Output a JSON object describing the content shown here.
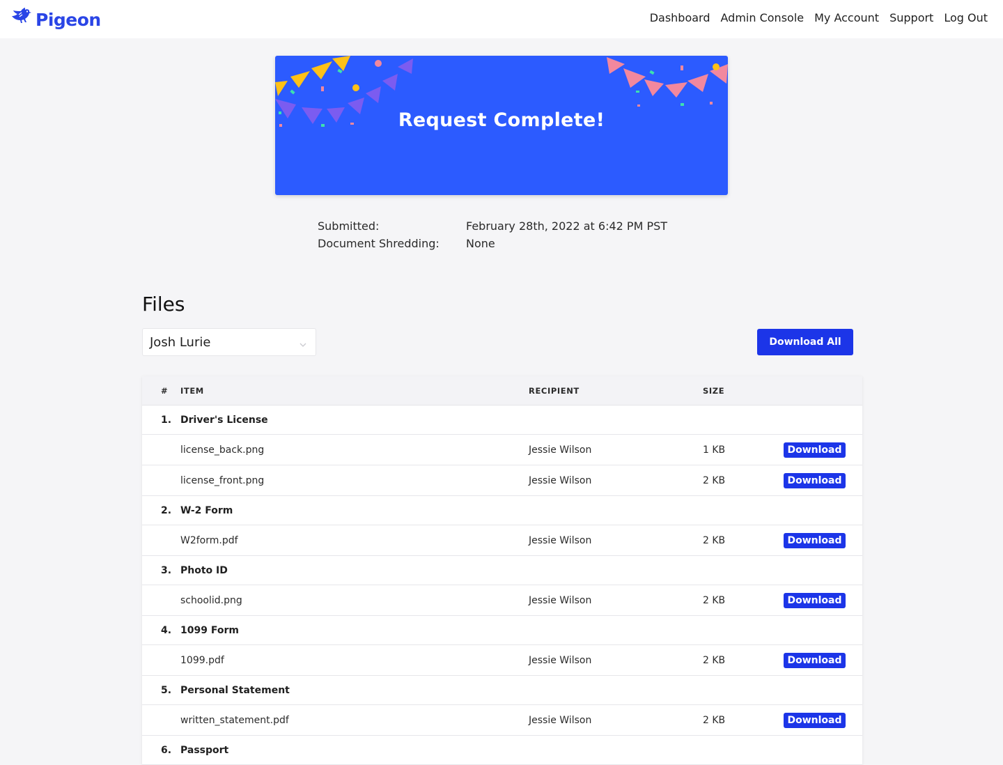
{
  "header": {
    "logo_text": "Pigeon",
    "logo_icon": "pigeon-bird-icon",
    "nav": [
      "Dashboard",
      "Admin Console",
      "My Account",
      "Support",
      "Log Out"
    ]
  },
  "banner": {
    "title": "Request Complete!",
    "background": "#2c5bff"
  },
  "meta": {
    "submitted_label": "Submitted:",
    "submitted_value": "February 28th, 2022 at 6:42 PM PST",
    "shredding_label": "Document Shredding:",
    "shredding_value": "None"
  },
  "files": {
    "title": "Files",
    "selected_person": "Josh Lurie",
    "download_all_label": "Download All",
    "columns": {
      "num": "#",
      "item": "ITEM",
      "recipient": "RECIPIENT",
      "size": "SIZE"
    },
    "download_label": "Download",
    "groups": [
      {
        "num": "1.",
        "name": "Driver's License",
        "files": [
          {
            "name": "license_back.png",
            "recipient": "Jessie Wilson",
            "size": "1 KB"
          },
          {
            "name": "license_front.png",
            "recipient": "Jessie Wilson",
            "size": "2 KB"
          }
        ]
      },
      {
        "num": "2.",
        "name": "W-2 Form",
        "files": [
          {
            "name": "W2form.pdf",
            "recipient": "Jessie Wilson",
            "size": "2 KB"
          }
        ]
      },
      {
        "num": "3.",
        "name": "Photo ID",
        "files": [
          {
            "name": "schoolid.png",
            "recipient": "Jessie Wilson",
            "size": "2 KB"
          }
        ]
      },
      {
        "num": "4.",
        "name": "1099 Form",
        "files": [
          {
            "name": "1099.pdf",
            "recipient": "Jessie Wilson",
            "size": "2 KB"
          }
        ]
      },
      {
        "num": "5.",
        "name": "Personal Statement",
        "files": [
          {
            "name": "written_statement.pdf",
            "recipient": "Jessie Wilson",
            "size": "2 KB"
          }
        ]
      },
      {
        "num": "6.",
        "name": "Passport",
        "files": []
      }
    ]
  },
  "colors": {
    "accent": "#1c35e8",
    "brand": "#2a45e6"
  }
}
